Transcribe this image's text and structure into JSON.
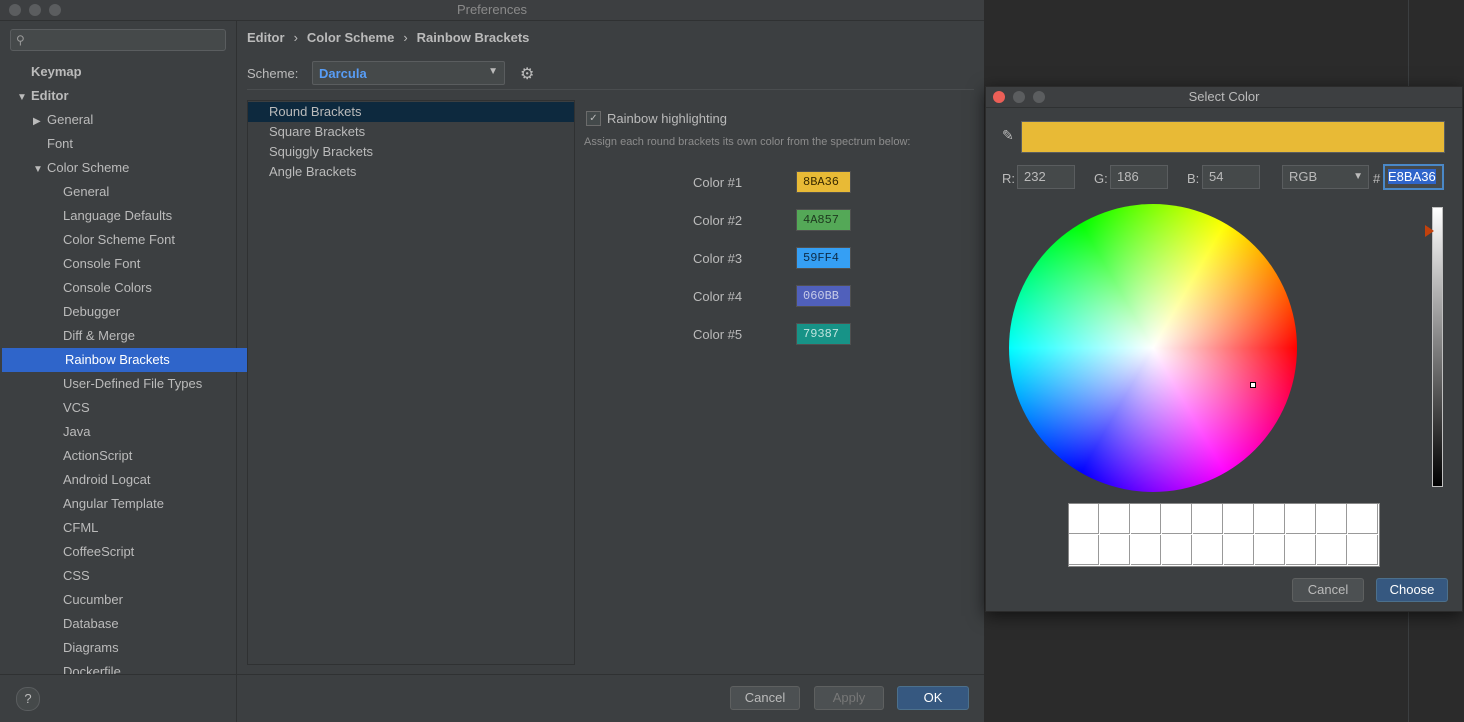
{
  "window_title": "Preferences",
  "search": {
    "placeholder": ""
  },
  "sidebar": {
    "items": [
      {
        "label": "Keymap"
      },
      {
        "label": "Editor"
      },
      {
        "label": "General"
      },
      {
        "label": "Font"
      },
      {
        "label": "Color Scheme"
      },
      {
        "label": "General"
      },
      {
        "label": "Language Defaults"
      },
      {
        "label": "Color Scheme Font"
      },
      {
        "label": "Console Font"
      },
      {
        "label": "Console Colors"
      },
      {
        "label": "Debugger"
      },
      {
        "label": "Diff & Merge"
      },
      {
        "label": "Rainbow Brackets"
      },
      {
        "label": "User-Defined File Types"
      },
      {
        "label": "VCS"
      },
      {
        "label": "Java"
      },
      {
        "label": "ActionScript"
      },
      {
        "label": "Android Logcat"
      },
      {
        "label": "Angular Template"
      },
      {
        "label": "CFML"
      },
      {
        "label": "CoffeeScript"
      },
      {
        "label": "CSS"
      },
      {
        "label": "Cucumber"
      },
      {
        "label": "Database"
      },
      {
        "label": "Diagrams"
      },
      {
        "label": "Dockerfile"
      }
    ],
    "help_label": "?"
  },
  "breadcrumb": {
    "items": [
      "Editor",
      "Color Scheme",
      "Rainbow Brackets"
    ],
    "separator": "›"
  },
  "scheme": {
    "label": "Scheme:",
    "value": "Darcula"
  },
  "bracket_list": [
    "Round Brackets",
    "Square Brackets",
    "Squiggly Brackets",
    "Angle Brackets"
  ],
  "rainbow": {
    "checkbox_label": "Rainbow highlighting",
    "checked": true,
    "hint": "Assign each round brackets its own color from the spectrum below:",
    "colors": [
      {
        "label": "Color #1",
        "hex": "8BA36",
        "swatch": "#e8ba36",
        "text_color": "#3a2b00"
      },
      {
        "label": "Color #2",
        "hex": "4A857",
        "swatch": "#54a857",
        "text_color": "#1e3a1f"
      },
      {
        "label": "Color #3",
        "hex": "59FF4",
        "swatch": "#359ff4",
        "text_color": "#0d2d4a"
      },
      {
        "label": "Color #4",
        "hex": "060BB",
        "swatch": "#5060bb",
        "text_color": "#c7cbe8"
      },
      {
        "label": "Color #5",
        "hex": "79387",
        "swatch": "#179387",
        "text_color": "#bfe4df"
      }
    ]
  },
  "buttons": {
    "cancel": "Cancel",
    "apply": "Apply",
    "ok": "OK"
  },
  "color_dialog": {
    "title": "Select Color",
    "preview_color": "#e8ba36",
    "r_label": "R:",
    "r": "232",
    "g_label": "G:",
    "g": "186",
    "b_label": "B:",
    "b": "54",
    "mode": "RGB",
    "hash": "#",
    "hex": "E8BA36",
    "cancel": "Cancel",
    "choose": "Choose"
  }
}
